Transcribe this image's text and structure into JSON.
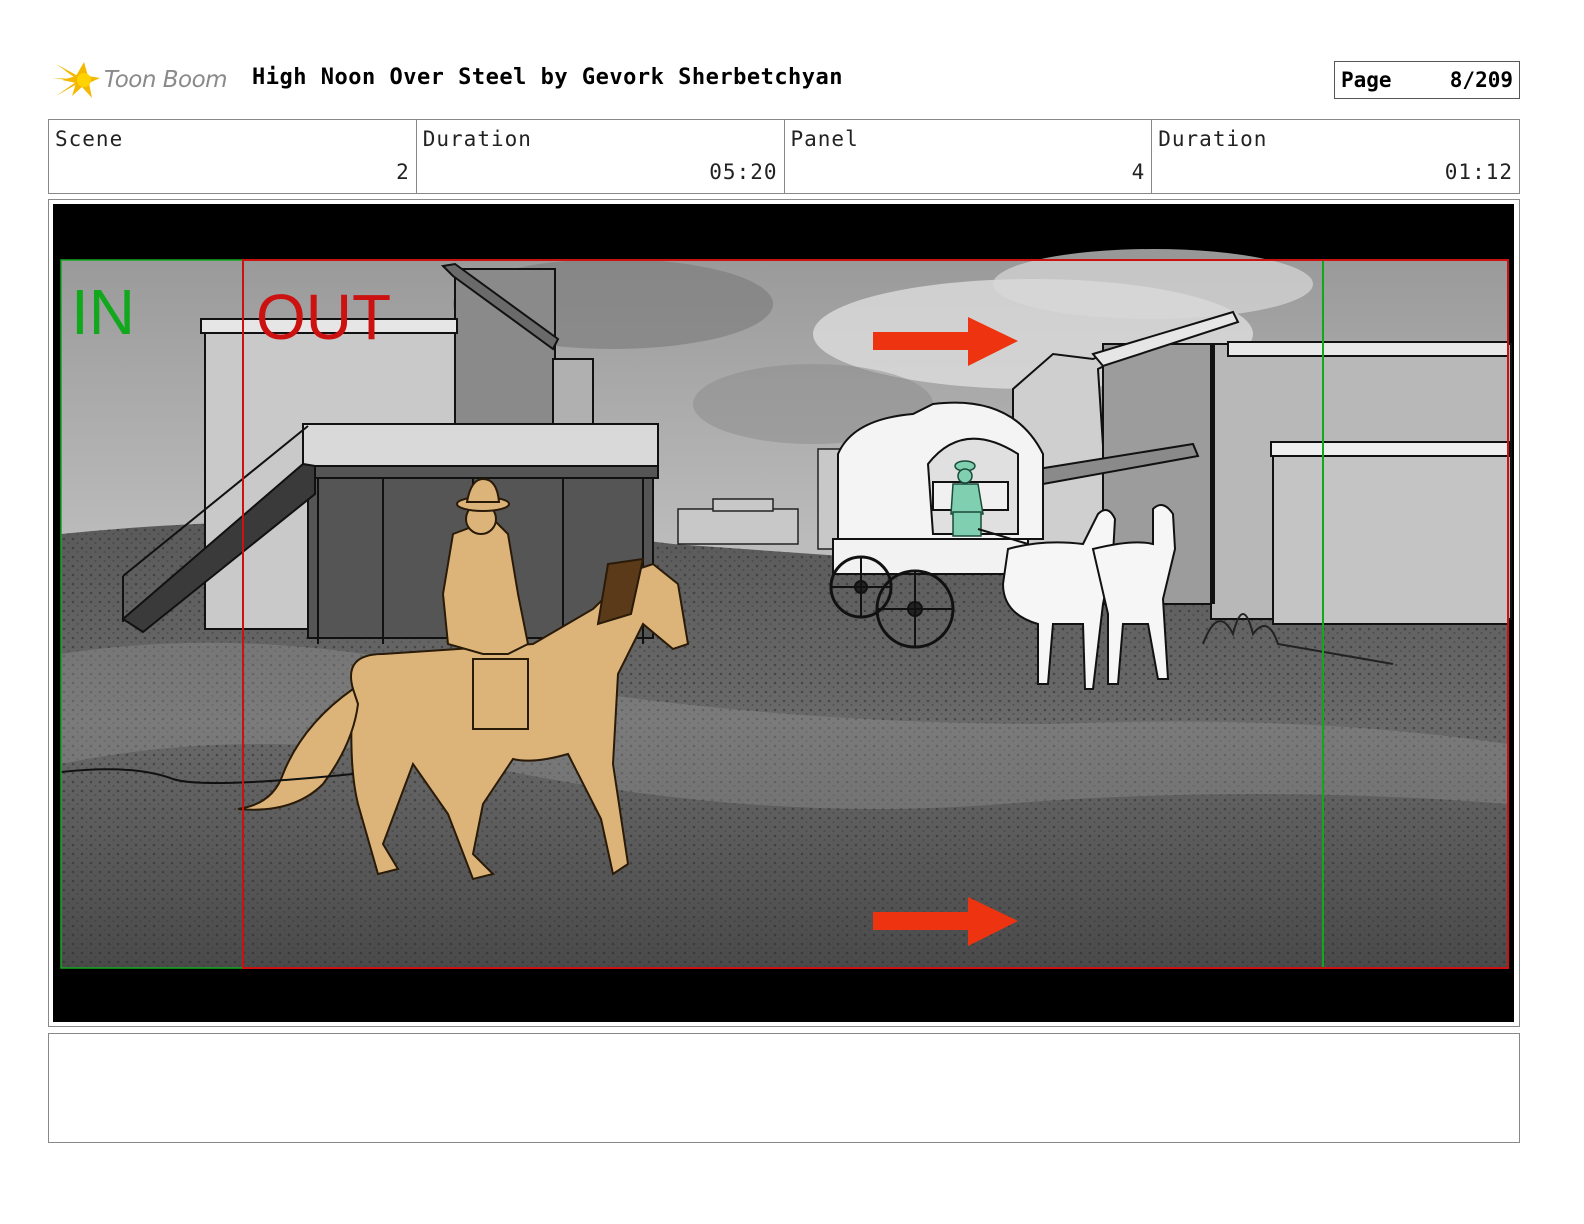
{
  "header": {
    "logo_text": "Toon Boom",
    "title": "High Noon Over Steel by Gevork Sherbetchyan",
    "page_label": "Page",
    "page_value": "8/209"
  },
  "info": {
    "scene_label": "Scene",
    "scene_value": "2",
    "scene_duration_label": "Duration",
    "scene_duration_value": "05:20",
    "panel_label": "Panel",
    "panel_value": "4",
    "panel_duration_label": "Duration",
    "panel_duration_value": "01:12"
  },
  "panel": {
    "in_label": "IN",
    "out_label": "OUT",
    "colors": {
      "in_marker": "#12a81e",
      "out_marker": "#cc1111",
      "arrow": "#ee3311",
      "rider_horse": "#dcb47a",
      "wagon_driver": "#7fcfb0"
    }
  },
  "notes": {
    "text": ""
  }
}
